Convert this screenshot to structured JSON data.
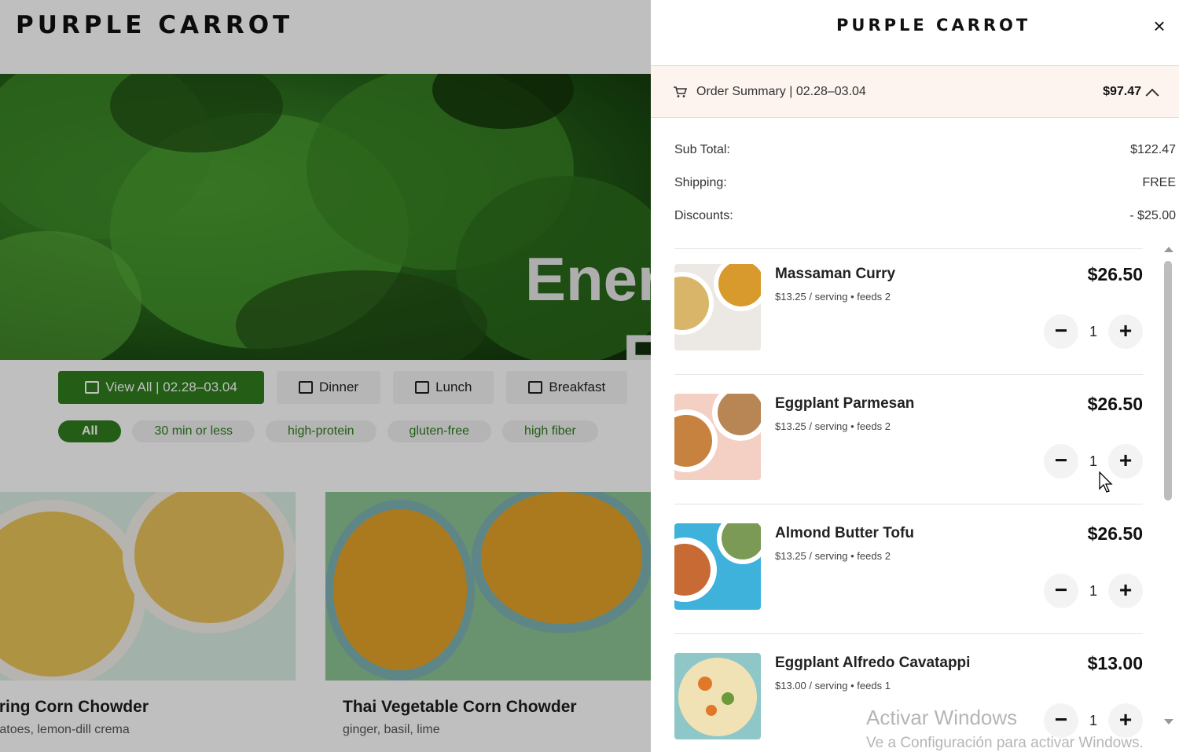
{
  "page": {
    "logo": "PURPLE CARROT",
    "hero_title_1": "Ener",
    "hero_title_2": "F",
    "tabs": [
      {
        "label": "View All | 02.28–03.04",
        "icon": "calendar-icon"
      },
      {
        "label": "Dinner",
        "icon": "dinner-icon"
      },
      {
        "label": "Lunch",
        "icon": "lunch-icon"
      },
      {
        "label": "Breakfast",
        "icon": "breakfast-icon"
      }
    ],
    "filters": [
      "All",
      "30 min or less",
      "high-protein",
      "gluten-free",
      "high fiber"
    ],
    "cards": [
      {
        "title": "pring Corn Chowder",
        "subtitle": "otatoes, lemon-dill crema"
      },
      {
        "title": "Thai Vegetable Corn Chowder",
        "subtitle": "ginger, basil, lime"
      }
    ]
  },
  "drawer": {
    "logo": "PURPLE CARROT",
    "close_label": "×",
    "summary": {
      "label": "Order Summary | 02.28–03.04",
      "total": "$97.47"
    },
    "totals": [
      {
        "label": "Sub Total:",
        "value": "$122.47"
      },
      {
        "label": "Shipping:",
        "value": "FREE"
      },
      {
        "label": "Discounts:",
        "value": "- $25.00"
      }
    ],
    "items": [
      {
        "name": "Massaman Curry",
        "meta": "$13.25 / serving • feeds 2",
        "price": "$26.50",
        "qty": "1"
      },
      {
        "name": "Eggplant Parmesan",
        "meta": "$13.25 / serving • feeds 2",
        "price": "$26.50",
        "qty": "1"
      },
      {
        "name": "Almond Butter Tofu",
        "meta": "$13.25 / serving • feeds 2",
        "price": "$26.50",
        "qty": "1"
      },
      {
        "name": "Eggplant Alfredo Cavatappi",
        "meta": "$13.00 / serving • feeds 1",
        "price": "$13.00",
        "qty": "1"
      }
    ],
    "stepper": {
      "minus": "−",
      "plus": "+"
    }
  },
  "watermark": {
    "line1": "Activar Windows",
    "line2": "Ve a Configuración para activar Windows."
  },
  "colors": {
    "brand_green": "#2f7d1e",
    "summary_bg": "#fdf4ef"
  }
}
